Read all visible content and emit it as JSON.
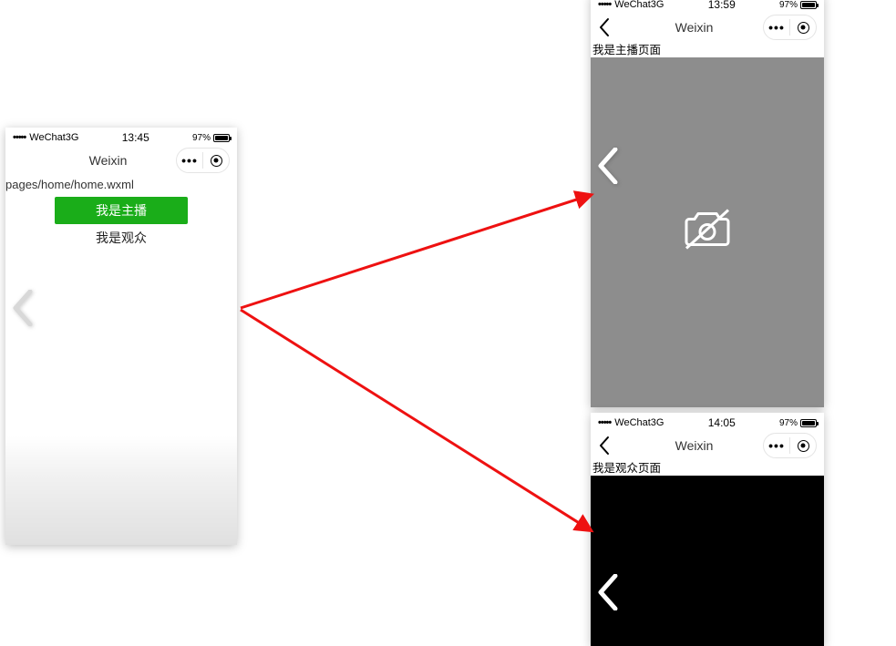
{
  "left": {
    "status": {
      "signal": "•••••",
      "carrier": "WeChat3G",
      "time": "13:45",
      "battery": "97%"
    },
    "title": "Weixin",
    "path": "pages/home/home.wxml",
    "btn_primary": "我是主播",
    "btn_plain": "我是观众"
  },
  "tr": {
    "status": {
      "signal": "•••••",
      "carrier": "WeChat3G",
      "time": "13:59",
      "battery": "97%"
    },
    "title": "Weixin",
    "page_label": "我是主播页面"
  },
  "br": {
    "status": {
      "signal": "•••••",
      "carrier": "WeChat3G",
      "time": "14:05",
      "battery": "97%"
    },
    "title": "Weixin",
    "page_label": "我是观众页面"
  }
}
